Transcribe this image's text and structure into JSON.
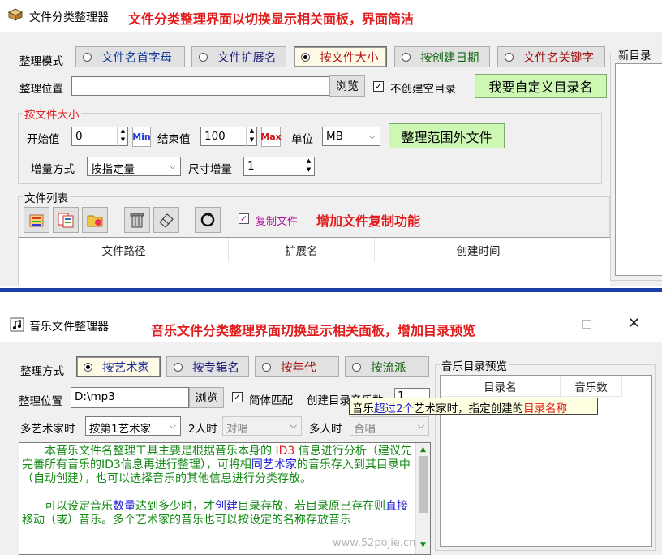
{
  "top": {
    "title": "文件分类整理器",
    "note": "文件分类整理界面以切换显示相关面板，界面简洁",
    "mode_label": "整理模式",
    "modes": [
      "文件名首字母",
      "文件扩展名",
      "按文件大小",
      "按创建日期",
      "文件名关键字"
    ],
    "new_dir_group": "新目录列",
    "location_label": "整理位置",
    "location_value": "",
    "browse": "浏览",
    "skip_empty": "不创建空目录",
    "custom_dir": "我要自定义目录名",
    "size_group": "按文件大小",
    "start_label": "开始值",
    "start_value": "0",
    "min_btn": "Min",
    "end_label": "结束值",
    "end_value": "100",
    "max_btn": "Max",
    "unit_label": "单位",
    "unit_value": "MB",
    "out_of_range": "整理范围外文件",
    "inc_mode_label": "增量方式",
    "inc_mode_value": "按指定量",
    "size_inc_label": "尺寸增量",
    "size_inc_value": "1",
    "file_list_group": "文件列表",
    "copy_files": "复制文件",
    "copy_note": "增加文件复制功能",
    "columns": [
      "文件路径",
      "扩展名",
      "创建时间"
    ]
  },
  "bottom": {
    "title": "音乐文件整理器",
    "note": "音乐文件分类整理界面切换显示相关面板，增加目录预览",
    "mode_label": "整理方式",
    "modes": [
      "按艺术家",
      "按专辑名",
      "按年代",
      "按流派"
    ],
    "preview_group": "音乐目录预览",
    "preview_cols": [
      "目录名",
      "音乐数"
    ],
    "location_label": "整理位置",
    "location_value": "D:\\mp3",
    "browse": "浏览",
    "fuzzy": "简体匹配",
    "create_dir_label": "创建目录音乐数",
    "create_dir_value": "1",
    "multi_artist_label": "多艺术家时",
    "multi_artist_value": "按第1艺术家",
    "two_label": "2人时",
    "two_value": "对唱",
    "many_label": "多人时",
    "many_value": "合唱",
    "tooltip_parts": [
      "音乐",
      "超过2个",
      "艺术家时，指定创建的",
      "目录名称"
    ],
    "desc_p1_parts": [
      "　　本音乐文件名整理工具主要是根据音乐本身的 ",
      "ID3",
      " 信息进行分析（建议先完善所有音乐的ID3信息再进行整理），可将相",
      "同艺术家",
      "的音乐存入到其目录中（自动创建），也可以选择音乐的其他信息进行分类存放。"
    ],
    "desc_p2_parts": [
      "　　可以设定音乐",
      "数量",
      "达到多少时，才",
      "创建",
      "目录存放，若目录原已存在则",
      "直接",
      "移动（或）音乐。多个艺术家的音乐也可以按设定的名称存放音乐"
    ],
    "watermark": "www.52pojie.cn"
  }
}
